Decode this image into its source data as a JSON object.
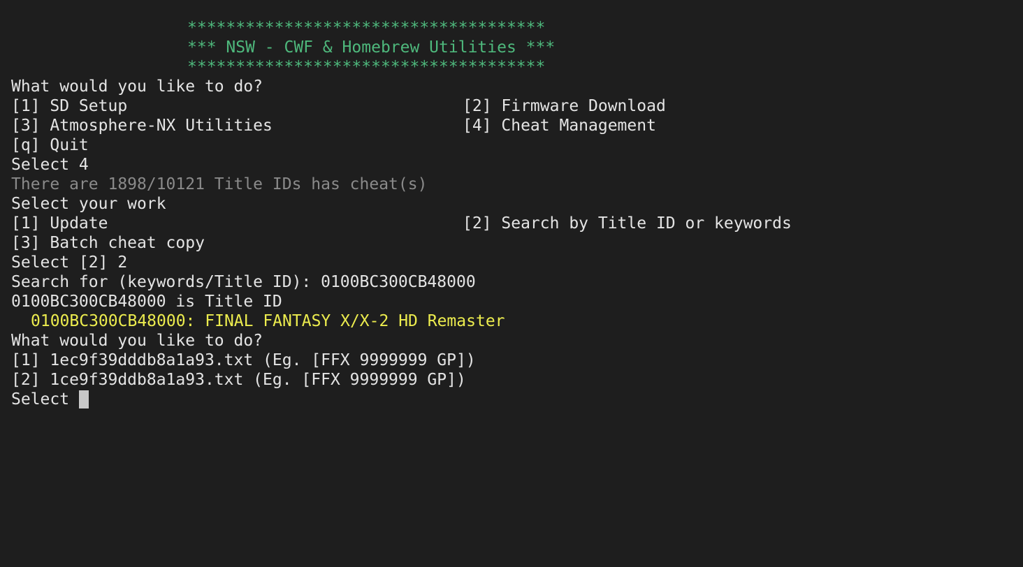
{
  "banner": {
    "top": "*************************************",
    "title": "*** NSW - CWF & Homebrew Utilities ***",
    "bottom": "*************************************"
  },
  "main_menu": {
    "prompt": "What would you like to do?",
    "option_1": "[1] SD Setup",
    "option_2": "[2] Firmware Download",
    "option_3": "[3] Atmosphere-NX Utilities",
    "option_4": "[4] Cheat Management",
    "option_q": "[q] Quit",
    "selection": "Select 4"
  },
  "cheat_menu": {
    "info": "There are 1898/10121 Title IDs has cheat(s)",
    "prompt": "Select your work",
    "option_1": "[1] Update",
    "option_2": "[2] Search by Title ID or keywords",
    "option_3": "[3] Batch cheat copy",
    "selection": "Select [2] 2"
  },
  "search": {
    "query_line": "Search for (keywords/Title ID): 0100BC300CB48000",
    "result_type": "0100BC300CB48000 is Title ID",
    "match": "0100BC300CB48000: FINAL FANTASY X/X-2 HD Remaster"
  },
  "file_menu": {
    "prompt": "What would you like to do?",
    "option_1": "[1] 1ec9f39dddb8a1a93.txt (Eg. [FFX 9999999 GP])",
    "option_2": "[2] 1ce9f39ddb8a1a93.txt (Eg. [FFX 9999999 GP])",
    "input_label": "Select "
  },
  "colors": {
    "background": "#1e1e1e",
    "text": "#e4e4e4",
    "banner": "#4eb87c",
    "dim": "#8a8a8a",
    "highlight": "#ecec4e"
  }
}
